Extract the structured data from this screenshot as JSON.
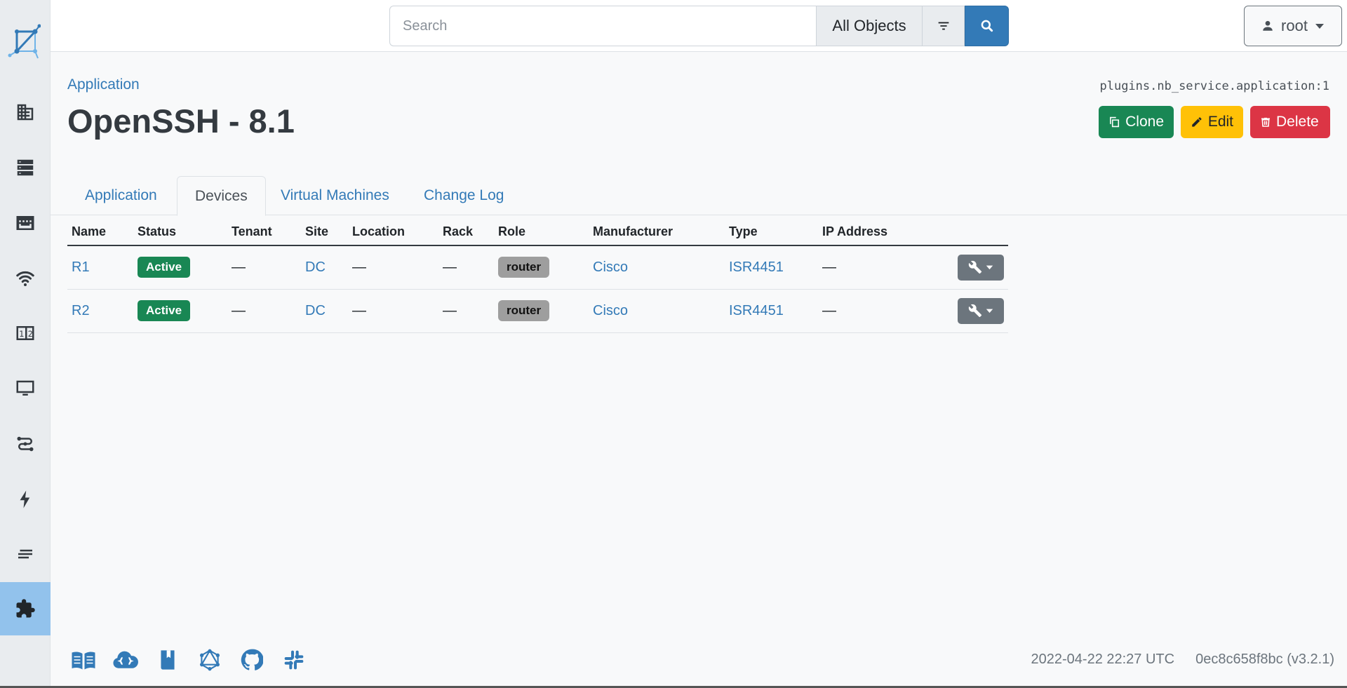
{
  "header": {
    "search_placeholder": "Search",
    "scope": "All Objects",
    "user": "root"
  },
  "page": {
    "breadcrumb": "Application",
    "title": "OpenSSH - 8.1",
    "object_id": "plugins.nb_service.application:1",
    "actions": {
      "clone": "Clone",
      "edit": "Edit",
      "delete": "Delete"
    }
  },
  "tabs": [
    "Application",
    "Devices",
    "Virtual Machines",
    "Change Log"
  ],
  "table": {
    "headers": [
      "Name",
      "Status",
      "Tenant",
      "Site",
      "Location",
      "Rack",
      "Role",
      "Manufacturer",
      "Type",
      "IP Address"
    ],
    "rows": [
      {
        "name": "R1",
        "status": "Active",
        "tenant": "—",
        "site": "DC",
        "location": "—",
        "rack": "—",
        "role": "router",
        "manufacturer": "Cisco",
        "type": "ISR4451",
        "ip": "—"
      },
      {
        "name": "R2",
        "status": "Active",
        "tenant": "—",
        "site": "DC",
        "location": "—",
        "rack": "—",
        "role": "router",
        "manufacturer": "Cisco",
        "type": "ISR4451",
        "ip": "—"
      }
    ]
  },
  "footer": {
    "timestamp": "2022-04-22 22:27 UTC",
    "version": "0ec8c658f8bc (v3.2.1)"
  },
  "colors": {
    "primary": "#337ab7",
    "success": "#198754",
    "warning": "#ffc107",
    "danger": "#dc3545",
    "sidebar_active": "#92c2ec"
  }
}
